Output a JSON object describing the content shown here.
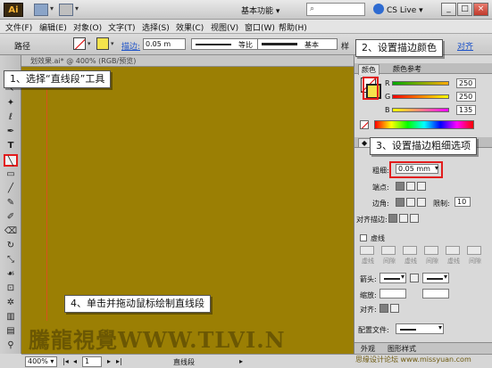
{
  "titlebar": {
    "logo": "Ai",
    "workspace": "基本功能",
    "cs_live": "CS Live",
    "window_buttons": [
      "_",
      "□",
      "×"
    ]
  },
  "menu": {
    "items": [
      "文件(F)",
      "编辑(E)",
      "对象(O)",
      "文字(T)",
      "选择(S)",
      "效果(C)",
      "视图(V)",
      "窗口(W)",
      "帮助(H)"
    ]
  },
  "controlbar": {
    "selection_label": "路径",
    "stroke_label": "描边:",
    "stroke_weight": "0.05 m",
    "profile_label": "等比",
    "brush_label": "基本",
    "opacity_label": "样",
    "align_link": "对齐"
  },
  "document": {
    "tab_label": "划效果.ai* @ 400% (RGB/预览)"
  },
  "tools": {
    "icons": [
      "selection-icon",
      "direct-selection-icon",
      "magic-wand-icon",
      "lasso-icon",
      "pen-icon",
      "type-icon",
      "line-segment-icon",
      "rectangle-icon",
      "paintbrush-icon",
      "pencil-icon",
      "blob-brush-icon",
      "eraser-icon",
      "rotate-icon",
      "scale-icon",
      "warp-icon",
      "free-transform-icon",
      "symbol-sprayer-icon",
      "graph-icon",
      "mesh-icon",
      "gradient-icon",
      "eyedropper-icon",
      "blend-icon",
      "live-paint-icon",
      "artboard-icon",
      "slice-icon",
      "hand-icon",
      "zoom-icon"
    ]
  },
  "statusbar": {
    "zoom": "400%",
    "page": "1",
    "tool_name": "直线段"
  },
  "color_panel": {
    "tabs": [
      "颜色",
      "颜色参考"
    ],
    "channels": [
      {
        "label": "R",
        "value": "250"
      },
      {
        "label": "G",
        "value": "250"
      },
      {
        "label": "B",
        "value": "135"
      }
    ]
  },
  "stroke_panel": {
    "weight_label": "粗细:",
    "weight_value": "0.05 mm",
    "cap_label": "端点:",
    "corner_label": "边角:",
    "limit_label": "限制:",
    "limit_value": "10",
    "align_label": "对齐描边:",
    "dashed_label": "虚线",
    "dash_sub": [
      "虚线",
      "间隙",
      "虚线",
      "间隙",
      "虚线",
      "间隙"
    ],
    "arrow_label": "箭头:",
    "scale_label": "缩放:",
    "align_arrow_label": "对齐:",
    "profile_label": "配置文件:"
  },
  "panel_bottom_tabs": [
    "外观",
    "图形样式"
  ],
  "callouts": {
    "step1": "1、选择“直线段”工具",
    "step2": "2、设置描边颜色",
    "step3": "3、设置描边粗细选项",
    "step4": "4、单击并拖动鼠标绘制直线段"
  },
  "watermark": "騰龍視覺WWW.TLVI.N",
  "watermark2": "思缘设计论坛 www.missyuan.com",
  "colors": {
    "canvas": "#9b7f04",
    "stroke_swatch": "#f5e34c",
    "highlight": "#e21c1c"
  }
}
